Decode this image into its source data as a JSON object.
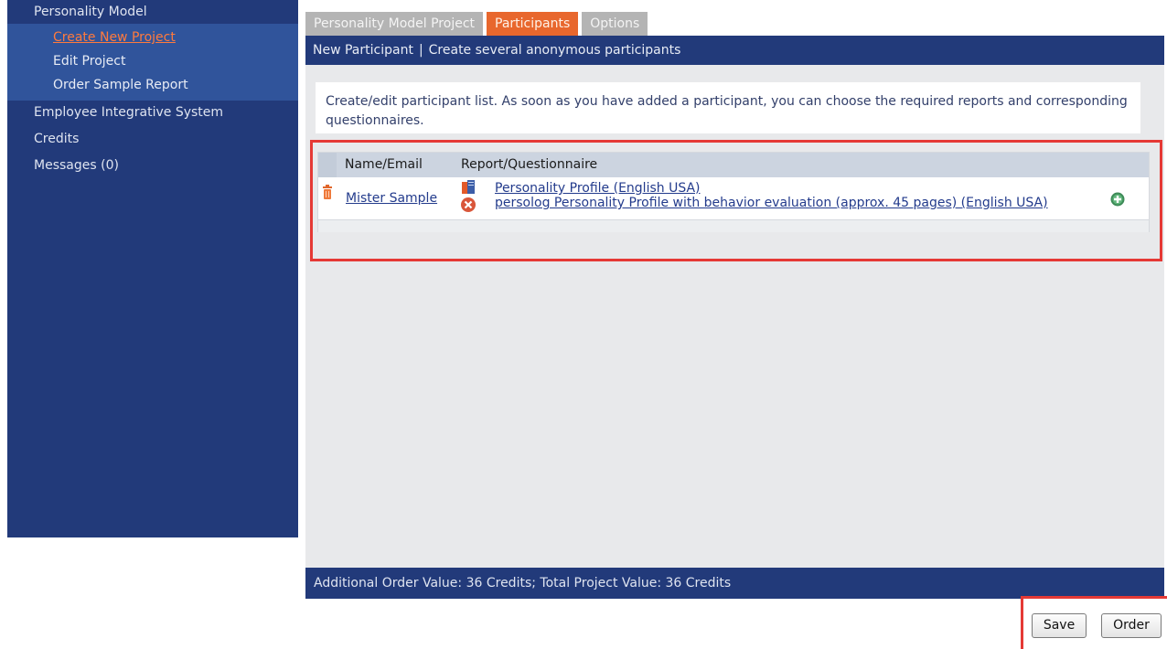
{
  "sidebar": {
    "items": [
      {
        "label": "Personality Model"
      },
      {
        "label": "Create New Project"
      },
      {
        "label": "Edit Project"
      },
      {
        "label": "Order Sample Report"
      },
      {
        "label": "Employee Integrative System"
      },
      {
        "label": "Credits"
      },
      {
        "label": "Messages (0)"
      }
    ]
  },
  "tabs": [
    {
      "label": "Personality Model Project"
    },
    {
      "label": "Participants"
    },
    {
      "label": "Options"
    }
  ],
  "subbar": {
    "new_participant": "New Participant",
    "separator": "|",
    "create_anonymous": "Create several anonymous participants"
  },
  "info": {
    "text": "Create/edit participant list. As soon as you have added a participant, you can choose the required reports and corresponding questionnaires."
  },
  "table": {
    "headers": {
      "name": "Name/Email",
      "report": "Report/Questionnaire"
    },
    "row": {
      "participant": "Mister Sample",
      "reports": [
        "Personality Profile (English USA)",
        "persolog Personality Profile with behavior evaluation (approx. 45 pages) (English USA)"
      ]
    }
  },
  "footer": {
    "summary": "Additional Order Value: 36 Credits; Total Project Value: 36 Credits"
  },
  "buttons": {
    "save": "Save",
    "order": "Order"
  },
  "colors": {
    "nav_bg": "#223a7a",
    "nav_sub_bg": "#30549b",
    "tab_active": "#e8672d",
    "tab_inactive": "#b4b4b4",
    "highlight": "#e53935"
  }
}
